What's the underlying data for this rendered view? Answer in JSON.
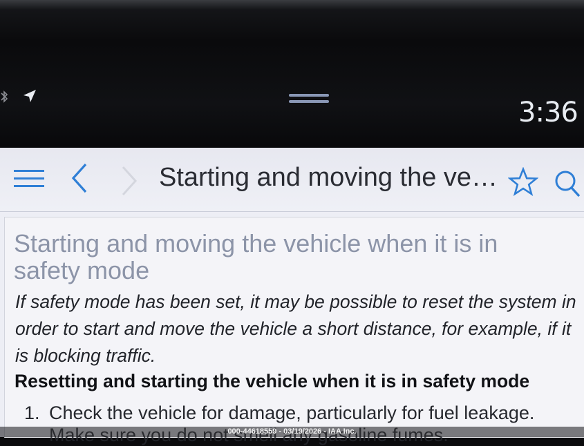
{
  "status_bar": {
    "time": "3:36",
    "icons": [
      "bluetooth-icon",
      "navigation-arrow-icon",
      "drag-handle-icon"
    ]
  },
  "header": {
    "title": "Starting and moving the ve…",
    "icons": [
      "menu-icon",
      "back-icon",
      "forward-icon",
      "star-icon",
      "search-icon"
    ]
  },
  "article": {
    "title": "Starting and moving the vehicle when it is in safety mode",
    "intro": "If safety mode has been set, it may be possible to reset the system in order to start and move the vehicle a short distance, for example, if it is blocking traffic.",
    "section_heading": "Resetting and starting the vehicle when it is in safety mode",
    "steps": [
      {
        "number": "1.",
        "text": "Check the vehicle for damage, particularly for fuel leakage."
      }
    ],
    "partial_next_line": "Make sure you do not smell any gasoline fumes."
  },
  "watermark": "000-44618559 - 03/19/2026 - IAA Inc.",
  "colors": {
    "accent_blue": "#2f7fd6",
    "title_gray": "#8c94a8",
    "background": "#edeef5"
  }
}
